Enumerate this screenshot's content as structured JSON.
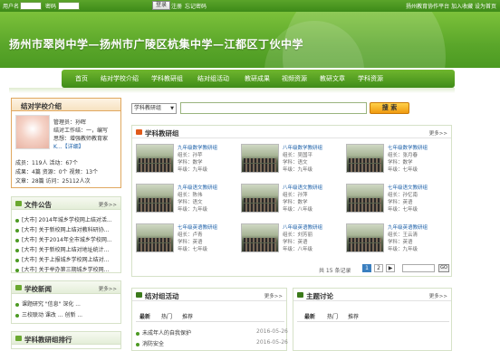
{
  "topbar": {
    "username_label": "用户名",
    "password_label": "密码",
    "login_button": "登录",
    "register_link": "注册",
    "forgot_link": "忘记密码",
    "right_links": "扬州教育协作平台 加入收藏 设为首页"
  },
  "banner": {
    "title": "扬州市翠岗中学—扬州市广陵区杭集中学—江都区丁伙中学"
  },
  "nav": [
    "首页",
    "结对学校介绍",
    "学科教研组",
    "结对组活动",
    "教研成果",
    "视频资源",
    "教研文章",
    "学科资源"
  ],
  "school_intro": {
    "title": "结对学校介绍",
    "admin": "管理员：孙晖",
    "work": "结对工作结：一，编写",
    "idea": "思想：增强教师教育家",
    "more": "K...【详细】",
    "stats1": "成员：119人  活动：67个",
    "stats2": "成果：4篇  资源：0个  视频：13个",
    "stats3": "文章：28篇  访问：25112人次"
  },
  "notice": {
    "title": "文件公告",
    "more": "更多>>",
    "items": [
      "[大市] 2014年城乡学校网上结对活...",
      "[大市] 关于新校网上结对教科研协...",
      "[大市] 关于2014年全市城乡学校网...",
      "[大市] 关于新校网上结对地址统计...",
      "[大市] 关于上报城乡学校网上结对...",
      "[大市] 关于举办第三期城乡学校网..."
    ]
  },
  "school_news": {
    "title": "学校新闻",
    "more": "更多>>",
    "items": [
      "课题研究 \"信息\" 深化 ...",
      "三校联动 课改 ... 创新 ..."
    ]
  },
  "ranking": {
    "title": "学科教研组排行"
  },
  "search": {
    "select": "学科教研组",
    "placeholder": "",
    "button": "搜 索"
  },
  "groups": {
    "title": "学科教研组",
    "more": "更多>>",
    "cards": [
      {
        "name": "九年级数学教研组",
        "leader": "组长：孙苹",
        "subject": "学科：数学",
        "grade": "年级：九年级"
      },
      {
        "name": "八年级数学教研组",
        "leader": "组长：吴国平",
        "subject": "学科：语文",
        "grade": "年级：九年级"
      },
      {
        "name": "七年级数学教研组",
        "leader": "组长：张月春",
        "subject": "学科：数学",
        "grade": "年级：七年级"
      },
      {
        "name": "九年级语文教研组",
        "leader": "组长：陈伟",
        "subject": "学科：语文",
        "grade": "年级：九年级"
      },
      {
        "name": "八年级语文教研组",
        "leader": "组长：孙萍",
        "subject": "学科：数学",
        "grade": "年级：八年级"
      },
      {
        "name": "七年级语文教研组",
        "leader": "组长：孙忆南",
        "subject": "学科：英语",
        "grade": "年级：七年级"
      },
      {
        "name": "七年级英语教研组",
        "leader": "组长：卢青",
        "subject": "学科：英语",
        "grade": "年级：七年级"
      },
      {
        "name": "八年级英语教研组",
        "leader": "组长：刘芳丽",
        "subject": "学科：英语",
        "grade": "年级：八年级"
      },
      {
        "name": "九年级英语教研组",
        "leader": "组长：王云清",
        "subject": "学科：英语",
        "grade": "年级：九年级"
      }
    ],
    "pagination": {
      "total": "共 15 条记录",
      "page1": "1",
      "page2": "2",
      "go": "GO"
    }
  },
  "activity": {
    "title": "结对组活动",
    "more": "更多>>",
    "tabs": [
      "最新",
      "热门",
      "推荐"
    ],
    "items": [
      {
        "text": "未成年人的自我保护",
        "date": "2016-05-26"
      },
      {
        "text": "消防安全",
        "date": "2016-05-26"
      }
    ]
  },
  "topics": {
    "title": "主题讨论",
    "more": "更多>>",
    "tabs": [
      "最新",
      "热门",
      "推荐"
    ]
  }
}
